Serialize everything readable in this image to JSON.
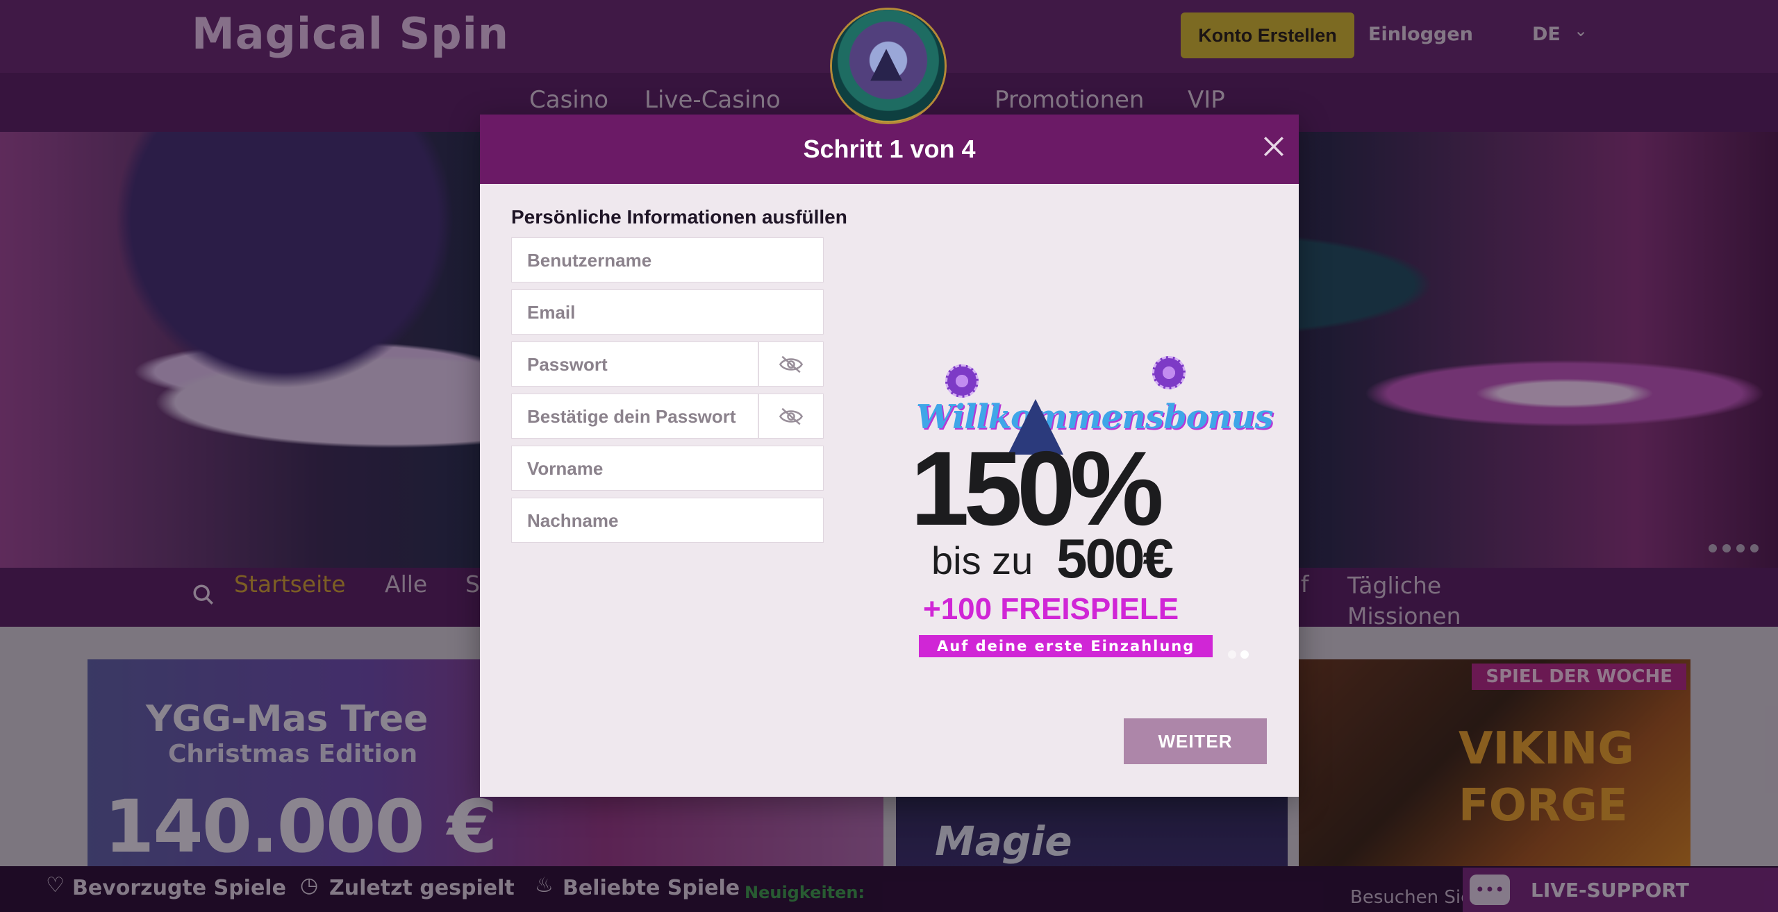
{
  "header": {
    "brand": "Magical Spin",
    "register_button": "Konto Erstellen",
    "login_link": "Einloggen",
    "language": "DE"
  },
  "main_nav": [
    {
      "label": "Casino"
    },
    {
      "label": "Live-Casino"
    },
    {
      "label": "Promotionen"
    },
    {
      "label": "VIP"
    }
  ],
  "category_nav": {
    "items": [
      {
        "label": "Startseite",
        "active": true
      },
      {
        "label": "Alle"
      },
      {
        "label": "S"
      },
      {
        "label": "uf"
      }
    ],
    "daily_missions": "Tägliche Missionen"
  },
  "tiles": {
    "t1_title": "YGG-Mas Tree",
    "t1_subtitle": "Christmas Edition",
    "t1_amount": "140.000 €",
    "t2_text": "Magie Verstärker",
    "t3_tag": "SPIEL DER WOCHE",
    "t3_title": "VIKING FORGE"
  },
  "bottom_bar": {
    "favorites": "Bevorzugte Spiele",
    "recent": "Zuletzt gespielt",
    "popular": "Beliebte Spiele",
    "news_label": "Neuigkeiten:",
    "visit_text": "Besuchen Sie",
    "live_support": "LIVE-SUPPORT"
  },
  "modal": {
    "title": "Schritt 1 von 4",
    "section_label": "Persönliche Informationen ausfüllen",
    "fields": {
      "username": "Benutzername",
      "email": "Email",
      "password": "Passwort",
      "confirm_password": "Bestätige dein Passwort",
      "first_name": "Vorname",
      "last_name": "Nachname"
    },
    "promo": {
      "welcome": "Willkommensbonus",
      "percent": "150%",
      "upto": "bis zu",
      "amount": "500€",
      "free_spins": "+100 FREISPIELE",
      "deposit": "Auf deine erste Einzahlung"
    },
    "next_button": "WEITER"
  },
  "colors": {
    "accent_purple": "#6b1a66",
    "button_gold": "#d8bf2f",
    "active_category": "#d8a932",
    "next_button": "#ad86a9"
  },
  "icons": {
    "search": "search-icon",
    "close": "close-icon",
    "eye": "eye-off-icon",
    "heart": "heart-icon",
    "clock": "clock-icon",
    "flame": "flame-icon",
    "chat": "chat-icon",
    "chevron": "chevron-down-icon"
  }
}
